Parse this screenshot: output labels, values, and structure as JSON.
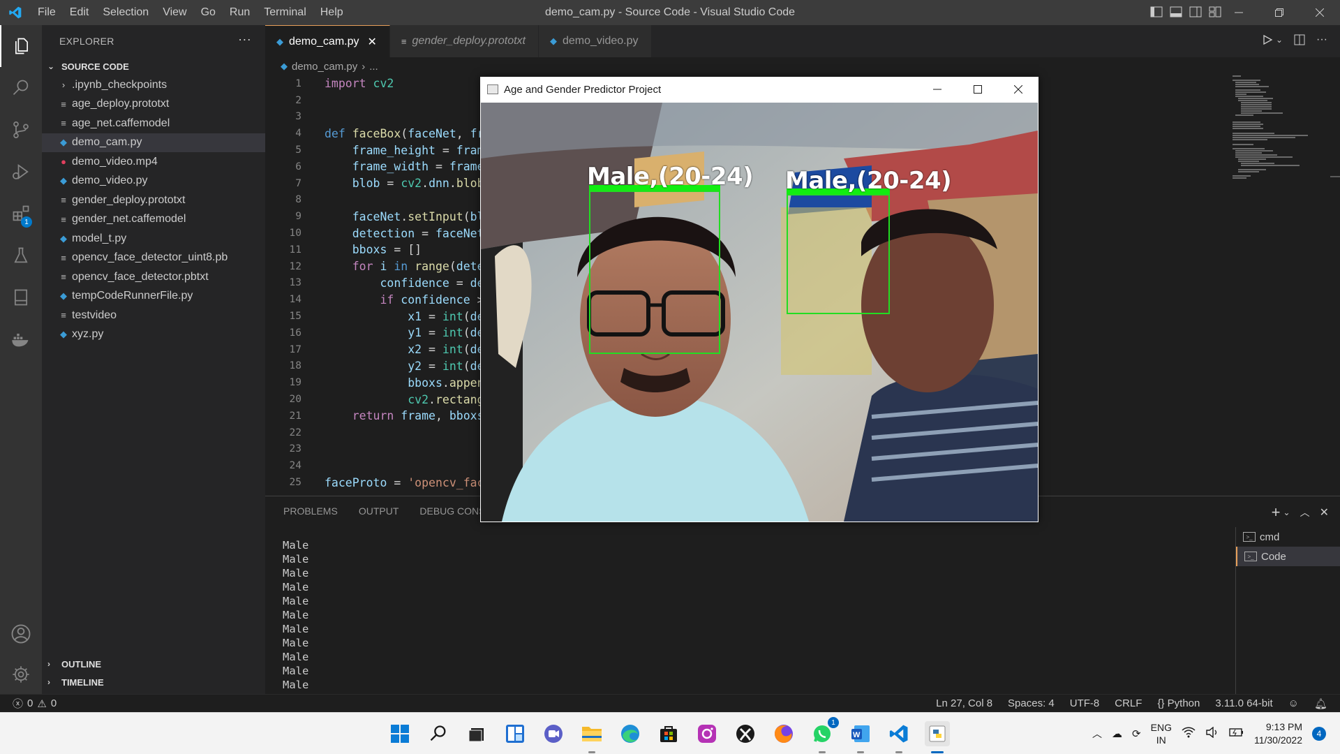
{
  "window": {
    "title": "demo_cam.py - Source Code - Visual Studio Code",
    "menu": [
      "File",
      "Edit",
      "Selection",
      "View",
      "Go",
      "Run",
      "Terminal",
      "Help"
    ]
  },
  "activity_bar": {
    "extensions_badge": "1"
  },
  "sidebar": {
    "title": "EXPLORER",
    "section": "SOURCE CODE",
    "files": [
      {
        "name": ".ipynb_checkpoints",
        "type": "folder"
      },
      {
        "name": "age_deploy.prototxt",
        "type": "txt"
      },
      {
        "name": "age_net.caffemodel",
        "type": "txt"
      },
      {
        "name": "demo_cam.py",
        "type": "py"
      },
      {
        "name": "demo_video.mp4",
        "type": "mp4"
      },
      {
        "name": "demo_video.py",
        "type": "py"
      },
      {
        "name": "gender_deploy.prototxt",
        "type": "txt"
      },
      {
        "name": "gender_net.caffemodel",
        "type": "txt"
      },
      {
        "name": "model_t.py",
        "type": "py"
      },
      {
        "name": "opencv_face_detector_uint8.pb",
        "type": "txt"
      },
      {
        "name": "opencv_face_detector.pbtxt",
        "type": "txt"
      },
      {
        "name": "tempCodeRunnerFile.py",
        "type": "py"
      },
      {
        "name": "testvideo",
        "type": "txt"
      },
      {
        "name": "xyz.py",
        "type": "py"
      }
    ],
    "outline": "OUTLINE",
    "timeline": "TIMELINE"
  },
  "tabs": [
    {
      "label": "demo_cam.py",
      "active": true
    },
    {
      "label": "gender_deploy.prototxt",
      "active": false
    },
    {
      "label": "demo_video.py",
      "active": false
    }
  ],
  "breadcrumb": {
    "file": "demo_cam.py",
    "rest": "..."
  },
  "code_lines": [
    {
      "n": "1",
      "html": "<span class='kw2'>import</span> <span class='bi'>cv2</span>"
    },
    {
      "n": "2",
      "html": ""
    },
    {
      "n": "3",
      "html": ""
    },
    {
      "n": "4",
      "html": "<span class='kw'>def</span> <span class='fn'>faceBox</span>(<span class='var'>faceNet</span>, <span class='var'>fr</span>"
    },
    {
      "n": "5",
      "html": "    <span class='var'>frame_height</span> = <span class='var'>fram</span>"
    },
    {
      "n": "6",
      "html": "    <span class='var'>frame_width</span> = <span class='var'>frame</span>"
    },
    {
      "n": "7",
      "html": "    <span class='var'>blob</span> = <span class='bi'>cv2</span>.<span class='var'>dnn</span>.<span class='fn'>blob</span>"
    },
    {
      "n": "8",
      "html": ""
    },
    {
      "n": "9",
      "html": "    <span class='var'>faceNet</span>.<span class='fn'>setInput</span>(<span class='var'>bl</span>"
    },
    {
      "n": "10",
      "html": "    <span class='var'>detection</span> = <span class='var'>faceNet</span>"
    },
    {
      "n": "11",
      "html": "    <span class='var'>bboxs</span> = []"
    },
    {
      "n": "12",
      "html": "    <span class='kw2'>for</span> <span class='var'>i</span> <span class='kw'>in</span> <span class='fn'>range</span>(<span class='var'>dete</span>"
    },
    {
      "n": "13",
      "html": "        <span class='var'>confidence</span> = <span class='var'>de</span>"
    },
    {
      "n": "14",
      "html": "        <span class='kw2'>if</span> <span class='var'>confidence</span> &gt;"
    },
    {
      "n": "15",
      "html": "            <span class='var'>x1</span> = <span class='cls'>int</span>(<span class='var'>de</span>"
    },
    {
      "n": "16",
      "html": "            <span class='var'>y1</span> = <span class='cls'>int</span>(<span class='var'>de</span>"
    },
    {
      "n": "17",
      "html": "            <span class='var'>x2</span> = <span class='cls'>int</span>(<span class='var'>de</span>"
    },
    {
      "n": "18",
      "html": "            <span class='var'>y2</span> = <span class='cls'>int</span>(<span class='var'>de</span>"
    },
    {
      "n": "19",
      "html": "            <span class='var'>bboxs</span>.<span class='fn'>appen</span>"
    },
    {
      "n": "20",
      "html": "            <span class='bi'>cv2</span>.<span class='fn'>rectang</span>"
    },
    {
      "n": "21",
      "html": "    <span class='kw2'>return</span> <span class='var'>frame</span>, <span class='var'>bboxs</span>"
    },
    {
      "n": "22",
      "html": ""
    },
    {
      "n": "23",
      "html": ""
    },
    {
      "n": "24",
      "html": ""
    },
    {
      "n": "25",
      "html": "<span class='var'>faceProto</span> = <span class='str'>'opencv_fac</span>"
    }
  ],
  "panel": {
    "tabs": [
      "PROBLEMS",
      "OUTPUT",
      "DEBUG CONSOLE"
    ],
    "terminal_lines": [
      "Male",
      "Male",
      "Male",
      "Male",
      "Male",
      "Male",
      "Male",
      "Male",
      "Male",
      "Male",
      "Male"
    ],
    "terminals": [
      "cmd",
      "Code"
    ]
  },
  "status": {
    "errors": "0",
    "warnings": "0",
    "position": "Ln 27, Col 8",
    "spaces": "Spaces: 4",
    "encoding": "UTF-8",
    "eol": "CRLF",
    "language": "Python",
    "interpreter": "3.11.0 64-bit"
  },
  "camera_window": {
    "title": "Age and Gender Predictor Project",
    "faces": [
      {
        "label": "Male,(20-24)"
      },
      {
        "label": "Male,(20-24)"
      }
    ]
  },
  "taskbar": {
    "apps": [
      "start",
      "search",
      "task-view",
      "widgets",
      "chat",
      "file-explorer",
      "edge",
      "store",
      "instagram",
      "xbox",
      "firefox",
      "whatsapp",
      "word",
      "vscode",
      "python"
    ],
    "whatsapp_badge": "1",
    "lang_line1": "ENG",
    "lang_line2": "IN",
    "time": "9:13 PM",
    "date": "11/30/2022",
    "notifications": "4"
  },
  "colors": {
    "accent": "#007acc",
    "tab_active_border": "#e8a05a",
    "face_box": "#22dd22"
  }
}
